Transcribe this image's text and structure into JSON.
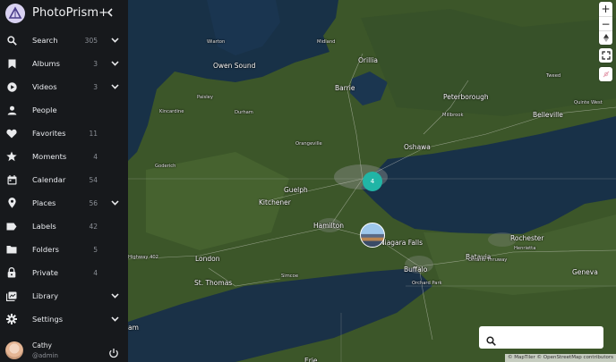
{
  "app": {
    "title": "PhotoPrism+"
  },
  "nav": [
    {
      "id": "search",
      "label": "Search",
      "count": "305",
      "chevron": true,
      "icon": "search-icon"
    },
    {
      "id": "albums",
      "label": "Albums",
      "count": "3",
      "chevron": true,
      "icon": "bookmark-icon"
    },
    {
      "id": "videos",
      "label": "Videos",
      "count": "3",
      "chevron": true,
      "icon": "play-circle-icon"
    },
    {
      "id": "people",
      "label": "People",
      "count": "",
      "chevron": false,
      "icon": "person-icon"
    },
    {
      "id": "favorites",
      "label": "Favorites",
      "count": "11",
      "chevron": false,
      "icon": "heart-icon"
    },
    {
      "id": "moments",
      "label": "Moments",
      "count": "4",
      "chevron": false,
      "icon": "star-icon"
    },
    {
      "id": "calendar",
      "label": "Calendar",
      "count": "54",
      "chevron": false,
      "icon": "calendar-icon"
    },
    {
      "id": "places",
      "label": "Places",
      "count": "56",
      "chevron": true,
      "icon": "place-pin-icon"
    },
    {
      "id": "labels",
      "label": "Labels",
      "count": "42",
      "chevron": false,
      "icon": "label-icon"
    },
    {
      "id": "folders",
      "label": "Folders",
      "count": "5",
      "chevron": false,
      "icon": "folder-icon"
    },
    {
      "id": "private",
      "label": "Private",
      "count": "4",
      "chevron": false,
      "icon": "lock-icon"
    },
    {
      "id": "library",
      "label": "Library",
      "count": "",
      "chevron": true,
      "icon": "library-icon"
    },
    {
      "id": "settings",
      "label": "Settings",
      "count": "",
      "chevron": true,
      "icon": "gear-icon"
    }
  ],
  "user": {
    "name": "Cathy",
    "handle": "@admin"
  },
  "map": {
    "cluster_count": "4",
    "places": [
      {
        "name": "Wiarton",
        "size": "small"
      },
      {
        "name": "Midland",
        "size": "small"
      },
      {
        "name": "Orillia",
        "size": "large"
      },
      {
        "name": "Owen Sound",
        "size": "large"
      },
      {
        "name": "Barrie",
        "size": "large"
      },
      {
        "name": "Tweed",
        "size": "small"
      },
      {
        "name": "Peterborough",
        "size": "large"
      },
      {
        "name": "Paisley",
        "size": "small"
      },
      {
        "name": "Millbrook",
        "size": "small"
      },
      {
        "name": "Kincardine",
        "size": "small"
      },
      {
        "name": "Durham",
        "size": "small"
      },
      {
        "name": "Belleville",
        "size": "large"
      },
      {
        "name": "Quinte West",
        "size": "small"
      },
      {
        "name": "Orangeville",
        "size": "small"
      },
      {
        "name": "Oshawa",
        "size": "large"
      },
      {
        "name": "Goderich",
        "size": "small"
      },
      {
        "name": "Guelph",
        "size": "large"
      },
      {
        "name": "Kitchener",
        "size": "large"
      },
      {
        "name": "Hamilton",
        "size": "large"
      },
      {
        "name": "Rochester",
        "size": "large"
      },
      {
        "name": "Niagara Falls",
        "size": "large"
      },
      {
        "name": "Henrietta",
        "size": "small"
      },
      {
        "name": "London",
        "size": "large"
      },
      {
        "name": "Batavia",
        "size": "large"
      },
      {
        "name": "Buffalo",
        "size": "large"
      },
      {
        "name": "Geneva",
        "size": "large"
      },
      {
        "name": "St. Thomas",
        "size": "large"
      },
      {
        "name": "Simcoe",
        "size": "small"
      },
      {
        "name": "Orchard Park",
        "size": "small"
      },
      {
        "name": "Erie",
        "size": "large"
      },
      {
        "name": "am",
        "size": "large"
      }
    ],
    "road_labels": [
      "Highway 402",
      "Ontario Thruway"
    ],
    "attribution": "© MapTiler © OpenStreetMap contributors",
    "search_placeholder": ""
  },
  "colors": {
    "sidebar_bg": "#17191c",
    "cluster": "#21b5a6",
    "land": "#3f5a2b",
    "water": "#173047"
  }
}
